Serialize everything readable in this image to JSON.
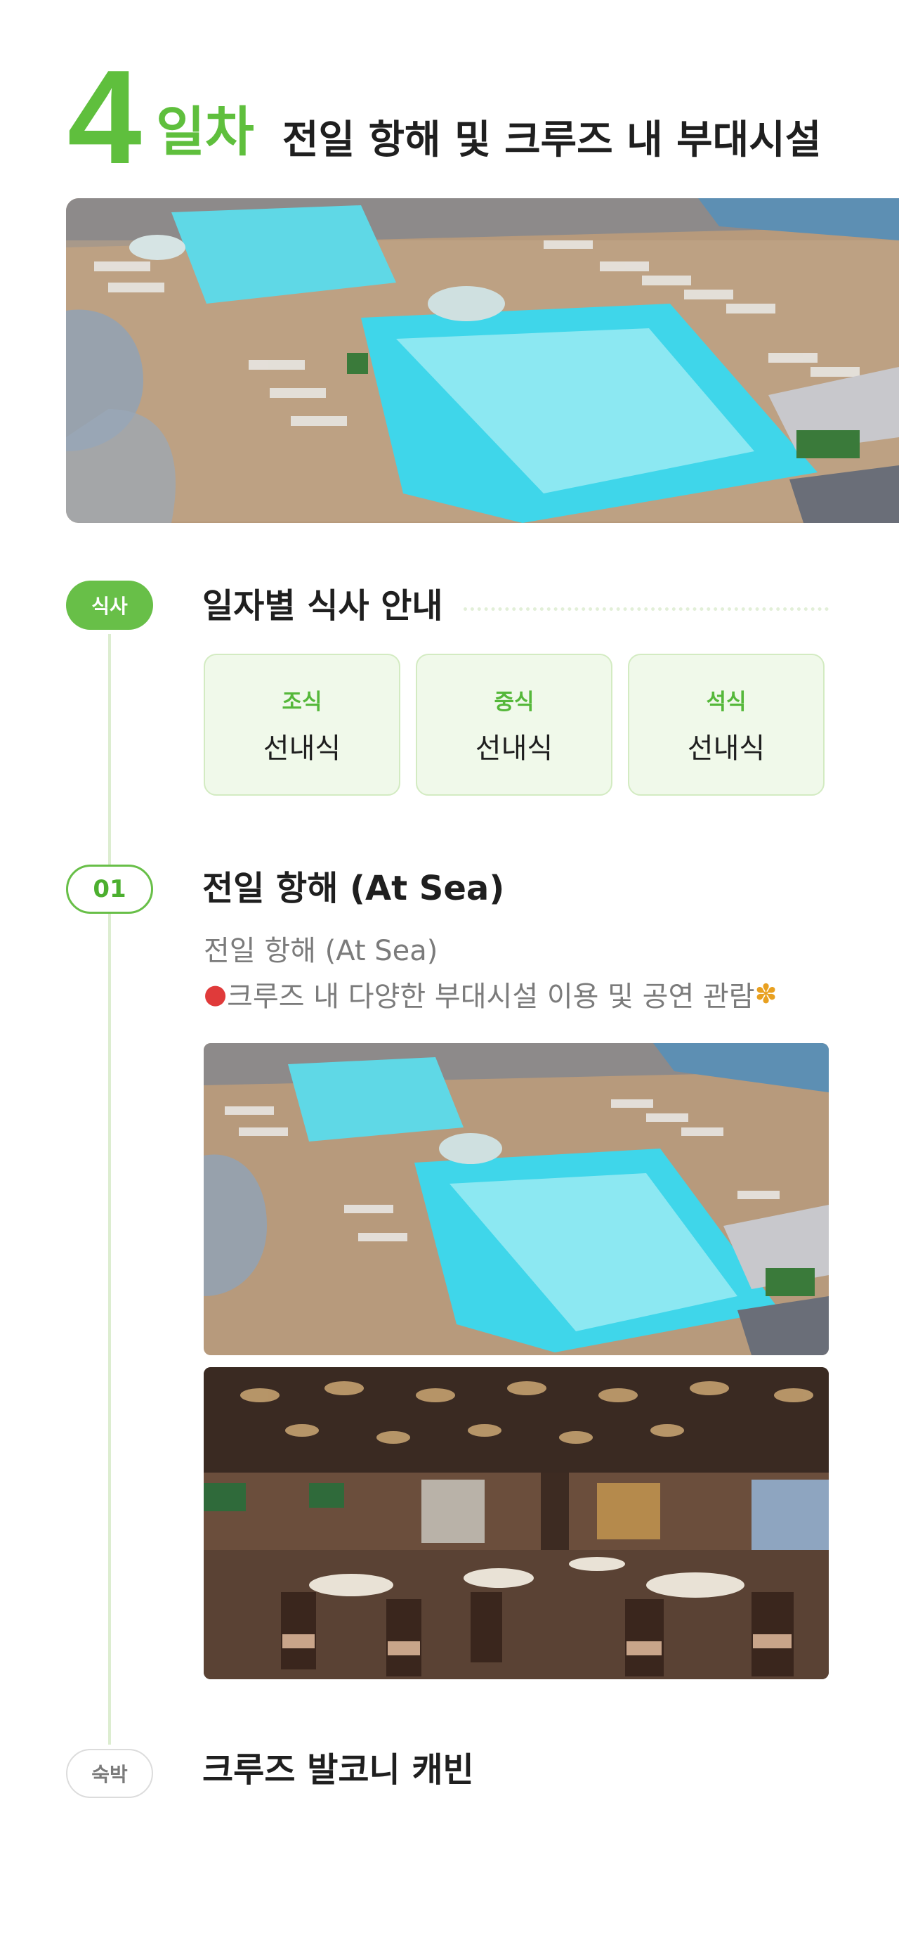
{
  "header": {
    "day_number": "4",
    "day_word": "일차",
    "title": "전일 항해 및 크루즈 내 부대시설"
  },
  "meals": {
    "badge": "식사",
    "title": "일자별 식사 안내",
    "items": [
      {
        "label": "조식",
        "value": "선내식"
      },
      {
        "label": "중식",
        "value": "선내식"
      },
      {
        "label": "석식",
        "value": "선내식"
      }
    ]
  },
  "itinerary": {
    "badge": "01",
    "title": "전일 항해 (At Sea)",
    "subtitle": "전일 항해 (At Sea)",
    "description": "크루즈 내 다양한 부대시설 이용 및 공연 관람",
    "icons": [
      "balloon-icon",
      "party-popper-icon"
    ]
  },
  "stay": {
    "badge": "숙박",
    "title": "크루즈 발코니 캐빈"
  },
  "colors": {
    "accent": "#5fbf3d",
    "timeline_line": "#dcedd0",
    "card_bg": "#f0f9ea"
  }
}
